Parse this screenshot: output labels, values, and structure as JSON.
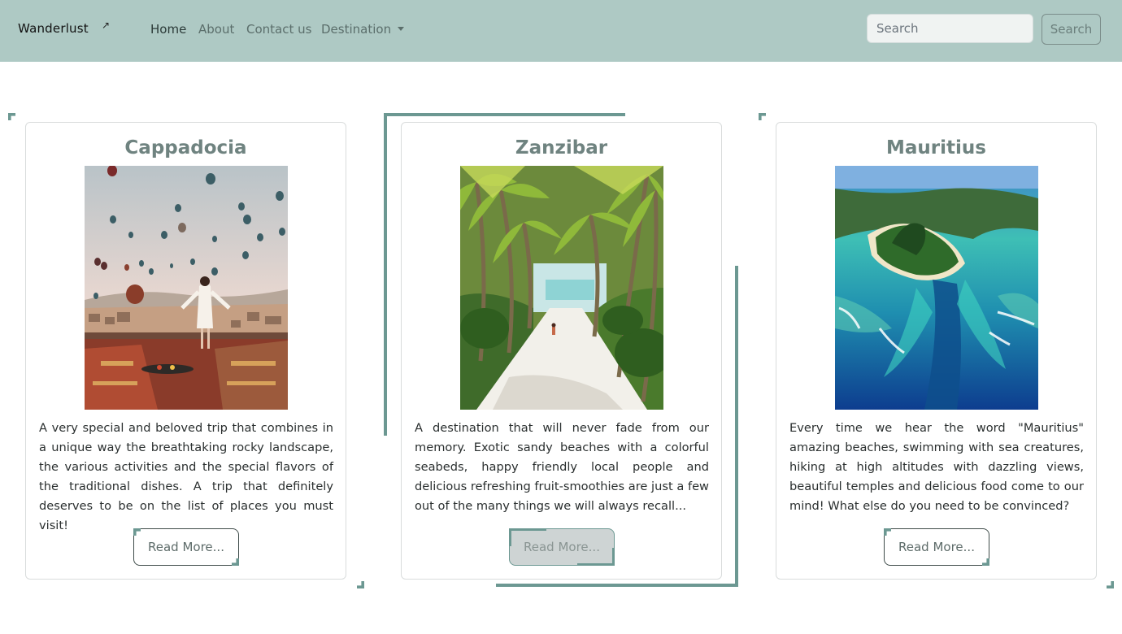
{
  "nav": {
    "brand": "Wanderlust",
    "brand_icon": "arrow-up-right-icon",
    "links": [
      "Home",
      "About",
      "Contact us",
      "Destination"
    ],
    "search_placeholder": "Search",
    "search_button": "Search"
  },
  "cards": [
    {
      "title": "Cappadocia",
      "text": "A very special and beloved trip that combines in a unique way the breathtaking rocky landscape, the various activities and the special flavors of the traditional dishes. A trip that definitely deserves to be on the list of places you must visit!",
      "button": "Read More..."
    },
    {
      "title": "Zanzibar",
      "text": "A destination that will never fade from our memory. Exotic sandy beaches with a colorful seabeds, happy friendly local people and delicious refreshing fruit-smoothies are just a few out of the many things we will always recall...",
      "button": "Read More..."
    },
    {
      "title": "Mauritius",
      "text": "Every time we hear the word \"Mauritius\" amazing beaches, swimming with sea creatures, hiking at high altitudes with dazzling views, beautiful temples and delicious food come to our mind! What else do you need to be convinced?",
      "button": "Read More..."
    }
  ],
  "colors": {
    "navbar": "#aec9c4",
    "accent": "#6c9892",
    "title": "#6f8380"
  }
}
